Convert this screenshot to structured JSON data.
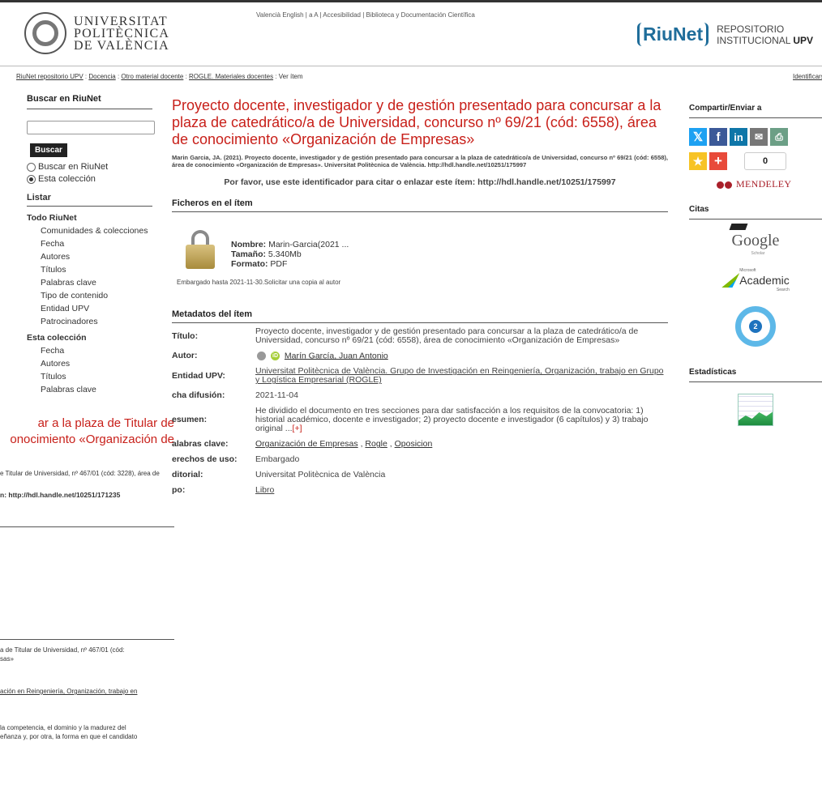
{
  "header": {
    "upv_logo_lines": [
      "UNIVERSITAT",
      "POLITÈCNICA",
      "DE VALÈNCIA"
    ],
    "top_links": "Valencià English | a A | Accesibilidad | Biblioteca y Documentación Científica",
    "riunet_word": "RiuNet",
    "riunet_sub1": "REPOSITORIO",
    "riunet_sub2": "INSTITUCIONAL",
    "riunet_sub3": "UPV"
  },
  "breadcrumb": {
    "items": [
      "RiuNet repositorio UPV",
      "Docencia",
      "Otro material docente",
      "ROGLE. Materiales docentes"
    ],
    "current": "Ver ítem",
    "right_link": "Identificarse"
  },
  "sidebar": {
    "search_heading": "Buscar en RiuNet",
    "search_value": "",
    "search_button": "Buscar",
    "radio_all": "Buscar en RiuNet",
    "radio_collection": "Esta colección",
    "listar_heading": "Listar",
    "group1_heading": "Todo RiuNet",
    "group1_items": [
      "Comunidades & colecciones",
      "Fecha",
      "Autores",
      "Títulos",
      "Palabras clave",
      "Tipo de contenido",
      "Entidad UPV",
      "Patrocinadores"
    ],
    "group2_heading": "Esta colección",
    "group2_items": [
      "Fecha",
      "Autores",
      "Títulos",
      "Palabras clave"
    ]
  },
  "item": {
    "title": "Proyecto docente, investigador y de gestión presentado para concursar a la plaza de catedrático/a de Universidad, concurso nº 69/21 (cód: 6558), área de conocimiento «Organización de Empresas»",
    "citation": "Marin Garcia, JA. (2021). Proyecto docente, investigador y de gestión presentado para concursar a la plaza de catedrático/a de Universidad, concurso nº 69/21 (cód: 6558), área de conocimiento «Organización de Empresas». Universitat Politècnica de València. http://hdl.handle.net/10251/175997",
    "permalink": "Por favor, use este identificador para citar o enlazar este ítem: http://hdl.handle.net/10251/175997",
    "files_heading": "Ficheros en el ítem",
    "file": {
      "name_label": "Nombre:",
      "name": "Marin-Garcia(2021 ...",
      "size_label": "Tamaño:",
      "size": "5.340Mb",
      "format_label": "Formato:",
      "format": "PDF"
    },
    "embargo": "Embargado hasta 2021-11-30.Solicitar una copia al autor",
    "metadata_heading": "Metadatos del ítem",
    "metadata": {
      "titulo_label": "Título:",
      "titulo": "Proyecto docente, investigador y de gestión presentado para concursar a la plaza de catedrático/a de Universidad, concurso nº 69/21 (cód: 6558), área de conocimiento «Organización de Empresas»",
      "autor_label": "Autor:",
      "autor": "Marín García, Juan Antonio",
      "orcid": "iD",
      "entidad_label": "Entidad UPV:",
      "entidad": "Universitat Politècnica de València. Grupo de Investigación en Reingeniería, Organización, trabajo en Grupo y Logística Empresarial (ROGLE)",
      "fecha_label": "cha difusión:",
      "fecha": "2021-11-04",
      "resumen_label": "esumen:",
      "resumen": "He dividido el documento en tres secciones para dar satisfacción a los requisitos de la convocatoria: 1) historial académico, docente e investigador; 2) proyecto docente e investigador (6 capítulos) y 3) trabajo original ...",
      "resumen_more": "[+]",
      "palabras_label": "alabras clave:",
      "palabras": [
        "Organización de Empresas",
        "Rogle",
        "Oposicion"
      ],
      "derechos_label": "erechos de uso:",
      "derechos": "Embargado",
      "editorial_label": "ditorial:",
      "editorial": "Universitat Politècnica de València",
      "tipo_label": "po:",
      "tipo": "Libro"
    }
  },
  "right": {
    "share_heading": "Compartir/Enviar a",
    "share_count": "0",
    "mendeley": "MENDELEY",
    "citas_heading": "Citas",
    "scholar": "Google",
    "scholar_sub": "Scholar",
    "academic_small": "Microsoft",
    "academic": "Academic",
    "academic_sub": "Search",
    "altmetric_score": "2",
    "stats_heading": "Estadísticas"
  },
  "ghost": {
    "title_line1": "ar a la plaza de Titular de",
    "title_line2": "onocimiento «Organización de",
    "cite_line": "e Titular de Universidad, nº 467/01 (cód: 3228), área de",
    "permalink_line": "n: http://hdl.handle.net/10251/171235",
    "meta_line1": "a de Titular de Universidad, nº 467/01 (cód:",
    "meta_line2": "sas»",
    "entity_line": "ación en Reingeniería, Organización, trabajo en",
    "abstract_line1": "la competencia, el dominio y la madurez del",
    "abstract_line2": "eñanza y, por otra, la forma en que el candidato"
  }
}
